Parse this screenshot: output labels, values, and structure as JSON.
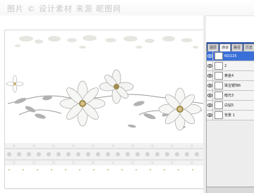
{
  "window": {
    "title": "图片 © 设计素材 来源 昵图网"
  },
  "layers_panel": {
    "tabs": [
      "图层",
      "通道",
      "路径",
      "历史"
    ],
    "layers": [
      {
        "name": "60/225",
        "active": true,
        "icon": "eye-icon"
      },
      {
        "name": "2",
        "active": false,
        "icon": "eye-icon"
      },
      {
        "name": "黄金4",
        "active": false,
        "icon": "eye-icon"
      },
      {
        "name": "珠宝银饰6",
        "active": false,
        "icon": "eye-icon"
      },
      {
        "name": "暗光3",
        "active": false,
        "icon": "eye-icon"
      },
      {
        "name": "白钻5",
        "active": false,
        "icon": "eye-icon"
      },
      {
        "name": "背景 1",
        "active": false,
        "icon": "eye-icon"
      }
    ]
  },
  "colors": {
    "accent": "#1f4aa8",
    "selection": "#3b6fd8",
    "panel": "#ededed"
  }
}
